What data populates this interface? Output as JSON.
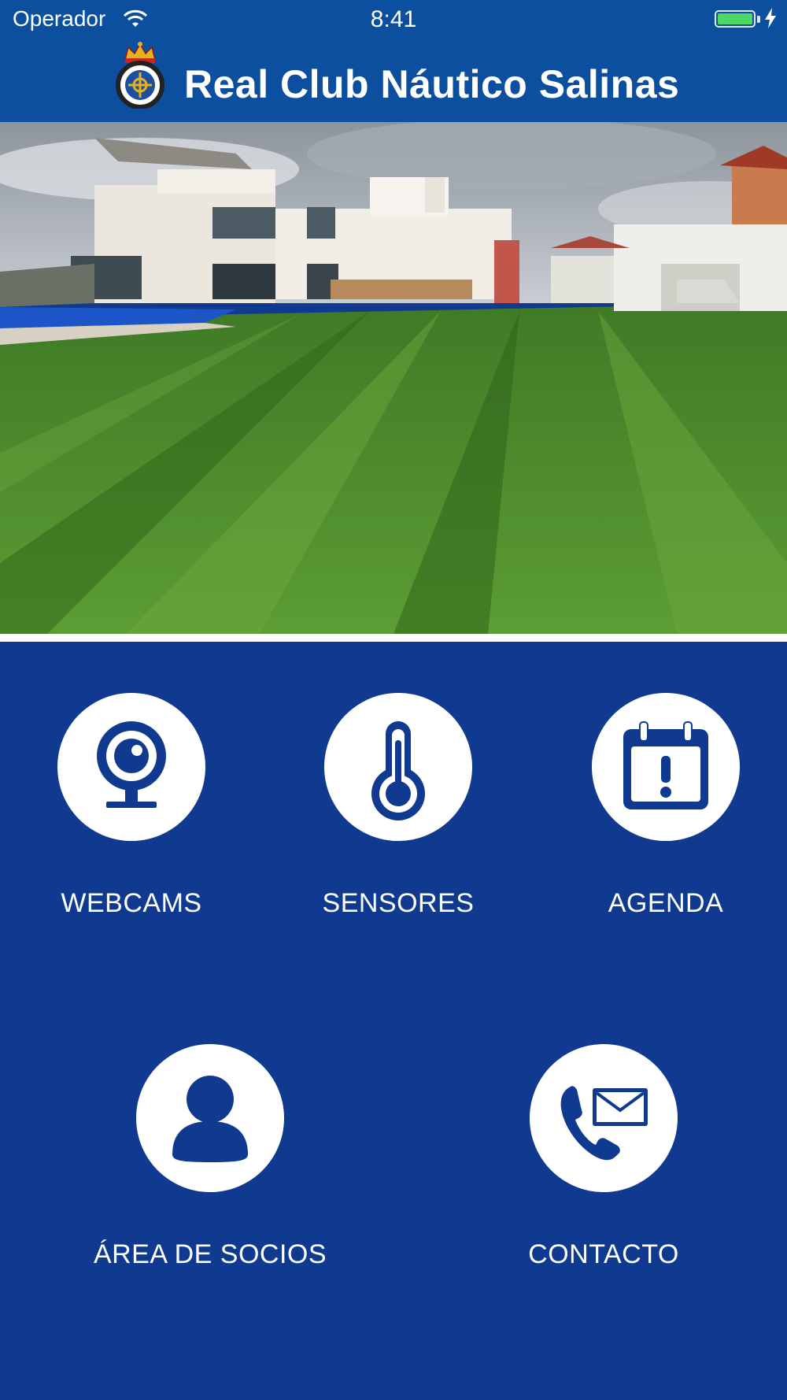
{
  "status_bar": {
    "carrier": "Operador",
    "time": "8:41"
  },
  "header": {
    "title": "Real Club Náutico Salinas"
  },
  "hero_image": {
    "alt": ""
  },
  "menu": [
    {
      "id": "webcams",
      "label": "WEBCAMS",
      "icon": "webcam-icon"
    },
    {
      "id": "sensores",
      "label": "SENSORES",
      "icon": "thermometer-icon"
    },
    {
      "id": "agenda",
      "label": "AGENDA",
      "icon": "calendar-alert-icon"
    },
    {
      "id": "area-socios",
      "label": "ÁREA DE SOCIOS",
      "icon": "user-icon"
    },
    {
      "id": "contacto",
      "label": "CONTACTO",
      "icon": "phone-mail-icon"
    }
  ],
  "colors": {
    "header_bg": "#0d4f9f",
    "content_bg": "#0f3a8f",
    "icon_fg": "#0f3a8f",
    "circle_bg": "#ffffff"
  }
}
